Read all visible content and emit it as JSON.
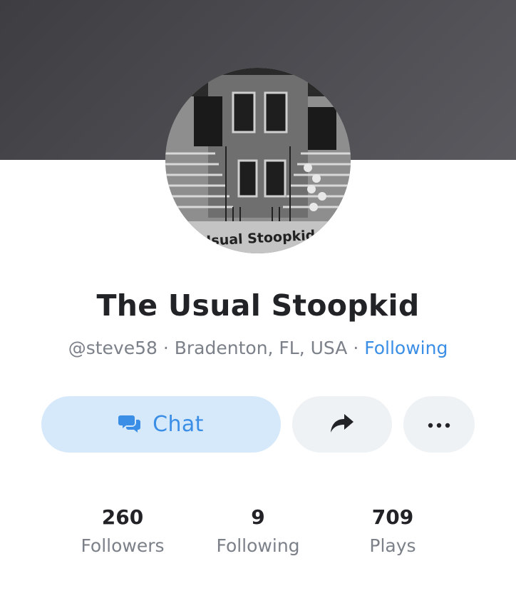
{
  "profile": {
    "display_name": "The Usual Stoopkid",
    "handle": "@steve58",
    "separator": "·",
    "location": "Bradenton, FL, USA",
    "follow_status": "Following",
    "avatar_caption": "Usual Stoopkid"
  },
  "actions": {
    "chat_label": "Chat",
    "chat_icon": "chat-bubbles-icon",
    "share_icon": "share-arrow-icon",
    "more_icon": "ellipsis-icon"
  },
  "stats": [
    {
      "value": "260",
      "label": "Followers"
    },
    {
      "value": "9",
      "label": "Following"
    },
    {
      "value": "709",
      "label": "Plays"
    }
  ],
  "colors": {
    "accent": "#3a8ee6",
    "chat_bg": "#d6e9fb",
    "button_bg": "#eff2f5",
    "banner": "#4a4a4f",
    "text_primary": "#222326",
    "text_secondary": "#7c8089"
  }
}
